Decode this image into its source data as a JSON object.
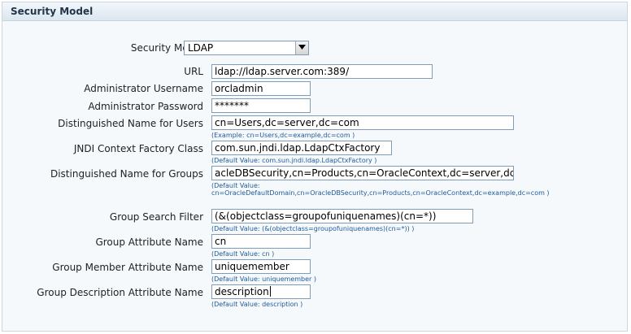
{
  "header": {
    "title": "Security Model"
  },
  "security_model": {
    "label": "Security Model",
    "value": "LDAP"
  },
  "fields": {
    "url": {
      "label": "URL",
      "value": "ldap://ldap.server.com:389/"
    },
    "admin_username": {
      "label": "Administrator Username",
      "value": "orcladmin"
    },
    "admin_password": {
      "label": "Administrator Password",
      "value": "*******"
    },
    "dn_users": {
      "label": "Distinguished Name for Users",
      "value": "cn=Users,dc=server,dc=com",
      "hint": "(Example: cn=Users,dc=example,dc=com )"
    },
    "jndi_factory": {
      "label": "JNDI Context Factory Class",
      "value": "com.sun.jndi.ldap.LdapCtxFactory",
      "hint": "(Default Value: com.sun.jndi.ldap.LdapCtxFactory )"
    },
    "dn_groups": {
      "label": "Distinguished Name for Groups",
      "value": "acleDBSecurity,cn=Products,cn=OracleContext,dc=server,dc=com",
      "hint": "(Default Value: cn=OracleDefaultDomain,cn=OracleDBSecurity,cn=Products,cn=OracleContext,dc=example,dc=com )"
    },
    "group_search_filter": {
      "label": "Group Search Filter",
      "value": "(&(objectclass=groupofuniquenames)(cn=*))",
      "hint": "(Default Value: (&(objectclass=groupofuniquenames)(cn=*)) )"
    },
    "group_attr_name": {
      "label": "Group Attribute Name",
      "value": "cn",
      "hint": "(Default Value: cn )"
    },
    "group_member_attr": {
      "label": "Group Member Attribute Name",
      "value": "uniquemember",
      "hint": "(Default Value: uniquemember )"
    },
    "group_desc_attr": {
      "label": "Group Description Attribute Name",
      "value": "description",
      "hint": "(Default Value: description )"
    }
  }
}
